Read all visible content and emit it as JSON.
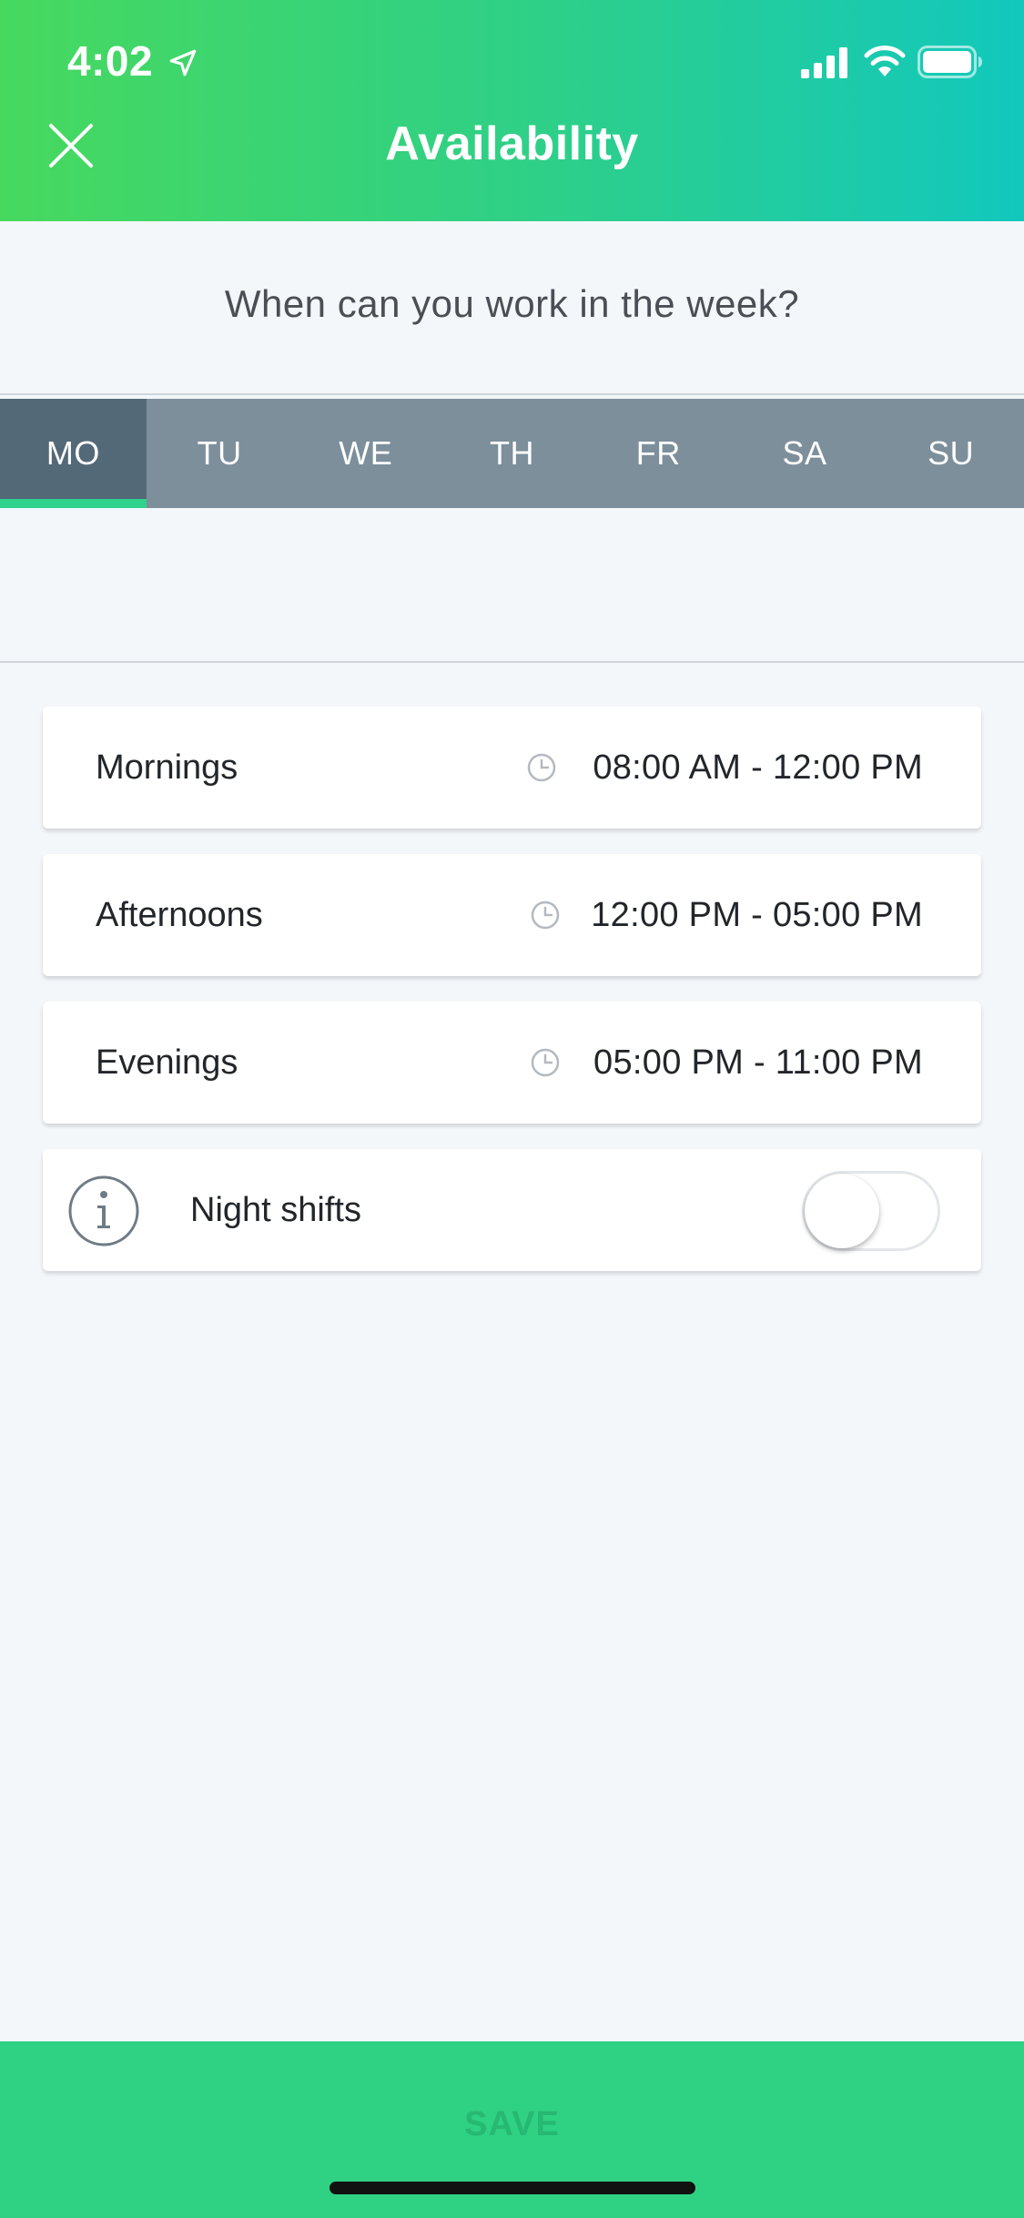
{
  "status_bar": {
    "time": "4:02",
    "location_icon": "location-arrow-icon",
    "signal_icon": "cellular-signal-icon",
    "wifi_icon": "wifi-icon",
    "battery_icon": "battery-icon"
  },
  "header": {
    "title": "Availability",
    "close_icon": "close-icon",
    "gradient_start": "#47d95e",
    "gradient_end": "#12c8bd"
  },
  "question": "When can you work in the week?",
  "days": [
    {
      "label": "MO",
      "active": true
    },
    {
      "label": "TU",
      "active": false
    },
    {
      "label": "WE",
      "active": false
    },
    {
      "label": "TH",
      "active": false
    },
    {
      "label": "FR",
      "active": false
    },
    {
      "label": "SA",
      "active": false
    },
    {
      "label": "SU",
      "active": false
    }
  ],
  "shifts": [
    {
      "label": "Mornings",
      "time": "08:00 AM - 12:00 PM",
      "icon": "clock-icon"
    },
    {
      "label": "Afternoons",
      "time": "12:00 PM - 05:00 PM",
      "icon": "clock-icon"
    },
    {
      "label": "Evenings",
      "time": "05:00 PM - 11:00 PM",
      "icon": "clock-icon"
    }
  ],
  "night_shifts": {
    "label": "Night shifts",
    "icon": "info-icon",
    "enabled": false
  },
  "save": {
    "label": "SAVE",
    "background": "#2fd183",
    "enabled": false
  },
  "colors": {
    "accent": "#2fd38e",
    "tab_active": "#536977",
    "tab_inactive": "#7d8f9b"
  }
}
